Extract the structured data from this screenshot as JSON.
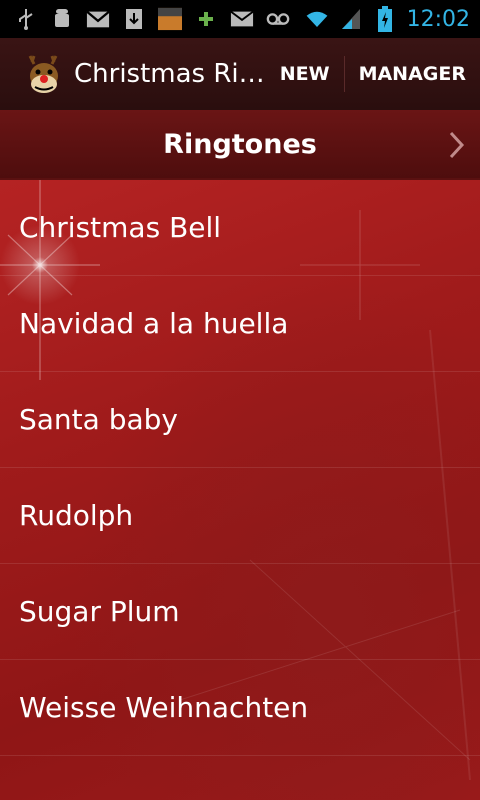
{
  "status_bar": {
    "time": "12:02",
    "left_icons": [
      "usb-icon",
      "android-debug-icon",
      "gmail-icon",
      "download-icon",
      "amazon-appstore-icon",
      "plus-icon",
      "mail-icon",
      "voicemail-icon"
    ],
    "right_icons": [
      "wifi-icon",
      "signal-icon",
      "battery-icon"
    ],
    "accent": "#33b5e5"
  },
  "action_bar": {
    "title": "Christmas Ri…",
    "new_label": "NEW",
    "manager_label": "MANAGER"
  },
  "tab": {
    "title": "Ringtones"
  },
  "ringtones": [
    {
      "label": "Christmas Bell"
    },
    {
      "label": "Navidad a la huella"
    },
    {
      "label": "Santa baby"
    },
    {
      "label": "Rudolph"
    },
    {
      "label": "Sugar Plum"
    },
    {
      "label": "Weisse Weihnachten"
    }
  ]
}
